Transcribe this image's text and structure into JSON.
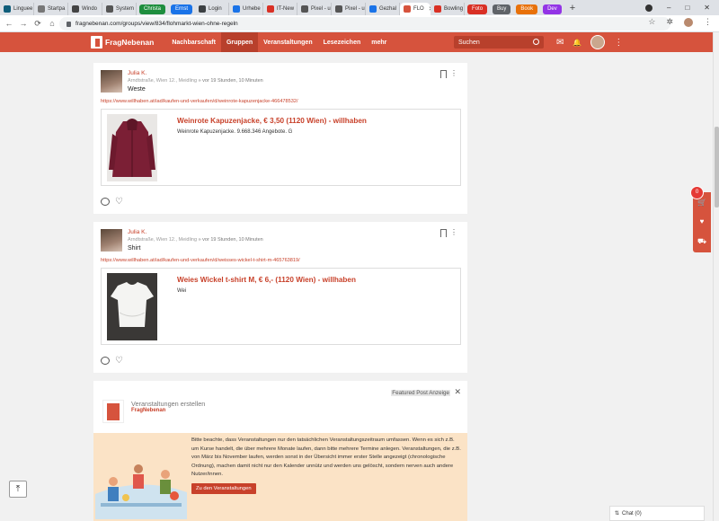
{
  "browser": {
    "tabs": [
      {
        "label": "Linguee",
        "color": "#0f5d7a"
      },
      {
        "label": "Startpa",
        "color": "#777777"
      },
      {
        "label": "Windo",
        "color": "#444444"
      },
      {
        "label": "System",
        "color": "#555555"
      }
    ],
    "pills": [
      {
        "label": "Christa",
        "color": "#1e8e3e"
      },
      {
        "label": "Ernst",
        "color": "#1a73e8"
      }
    ],
    "tabs2": [
      {
        "label": "Login",
        "color": "#3c4043"
      },
      {
        "label": "Urhebe",
        "color": "#1a73e8"
      },
      {
        "label": "IT-New",
        "color": "#d93025"
      },
      {
        "label": "Pixel - u",
        "color": "#555555"
      },
      {
        "label": "Pixel - u",
        "color": "#555555"
      },
      {
        "label": "Gezhal",
        "color": "#1a73e8"
      }
    ],
    "active_tab": {
      "label": "FLO",
      "color": "#d6533d"
    },
    "tabs3": [
      {
        "label": "Bowling",
        "color": "#d93025"
      }
    ],
    "pills2": [
      {
        "label": "Foto",
        "color": "#d93025"
      },
      {
        "label": "Buy",
        "color": "#5f6368"
      },
      {
        "label": "Book",
        "color": "#e8710a"
      },
      {
        "label": "Dev",
        "color": "#9334e6"
      }
    ],
    "new_tab": "+",
    "window_controls": [
      "–",
      "□",
      "✕"
    ],
    "url": "fragnebenan.com/groups/view/834/flohmarkt-wien-ohne-regeln",
    "nav": {
      "back": "←",
      "forward": "→",
      "reload": "⟳",
      "home": "⌂"
    },
    "addr_icons": {
      "star": "☆",
      "ext": "✲",
      "menu": "⋮"
    }
  },
  "header": {
    "logo_text": "FragNebenan",
    "nav": [
      {
        "label": "Nachbarschaft",
        "active": false
      },
      {
        "label": "Gruppen",
        "active": true
      },
      {
        "label": "Veranstaltungen",
        "active": false
      },
      {
        "label": "Lesezeichen",
        "active": false
      },
      {
        "label": "mehr",
        "active": false
      }
    ],
    "search_placeholder": "Suchen",
    "icons": {
      "mail": "✉",
      "bell": "🔔",
      "more": "⋮"
    }
  },
  "posts": [
    {
      "author": "Julia K.",
      "location": "Arndtstraße, Wien 12., Meidling",
      "time": "» vor 19 Stunden, 10 Minuten",
      "title": "Weste",
      "link": "https://www.willhaben.at/iad/kaufen-und-verkaufen/d/weinrote-kapuzenjacke-466478532/",
      "card_title": "Weinrote Kapuzenjacke, € 3,50 (1120 Wien) - willhaben",
      "card_desc": "Weinrote Kapuzenjacke. 9.668.346 Angebote. G"
    },
    {
      "author": "Julia K.",
      "location": "Arndtstraße, Wien 12., Meidling",
      "time": "» vor 19 Stunden, 10 Minuten",
      "title": "Shirt",
      "link": "https://www.willhaben.at/iad/kaufen-und-verkaufen/d/weisses-wickel-t-shirt-m-465763819/",
      "card_title": "Weies Wickel t-shirt M, € 6,- (1120 Wien) - willhaben",
      "card_desc": "Wei"
    }
  ],
  "featured": {
    "label": "Featured Post Anzeige",
    "title": "Veranstaltungen erstellen",
    "brand": "FragNebenan",
    "text": "Bitte beachte, dass Veranstaltungen nur den tatsächlichen Veranstaltungszeitraum umfassen. Wenn es sich z.B. um Kurse handelt, die über mehrere Monate laufen, dann bitte mehrere Termine anlegen. Veranstaltungen, die z.B. von März bis November laufen, werden sonst in der Übersicht immer erster Stelle angezeigt (chronologische Ordnung), machen damit nicht nur den Kalender unnütz und werden uns gelöscht, sondern nerven auch andere Nutzer/innen.",
    "button": "Zu den Veranstaltungen",
    "close": "✕"
  },
  "sidebar": {
    "cart_count": "0",
    "cart": "🛒",
    "heart": "♥",
    "truck": "⛟"
  },
  "chat": {
    "label": "Chat (0)"
  },
  "to_top": "⤒",
  "colors": {
    "brand": "#d6533d",
    "brand_dark": "#b8402c",
    "link": "#c8412a"
  }
}
